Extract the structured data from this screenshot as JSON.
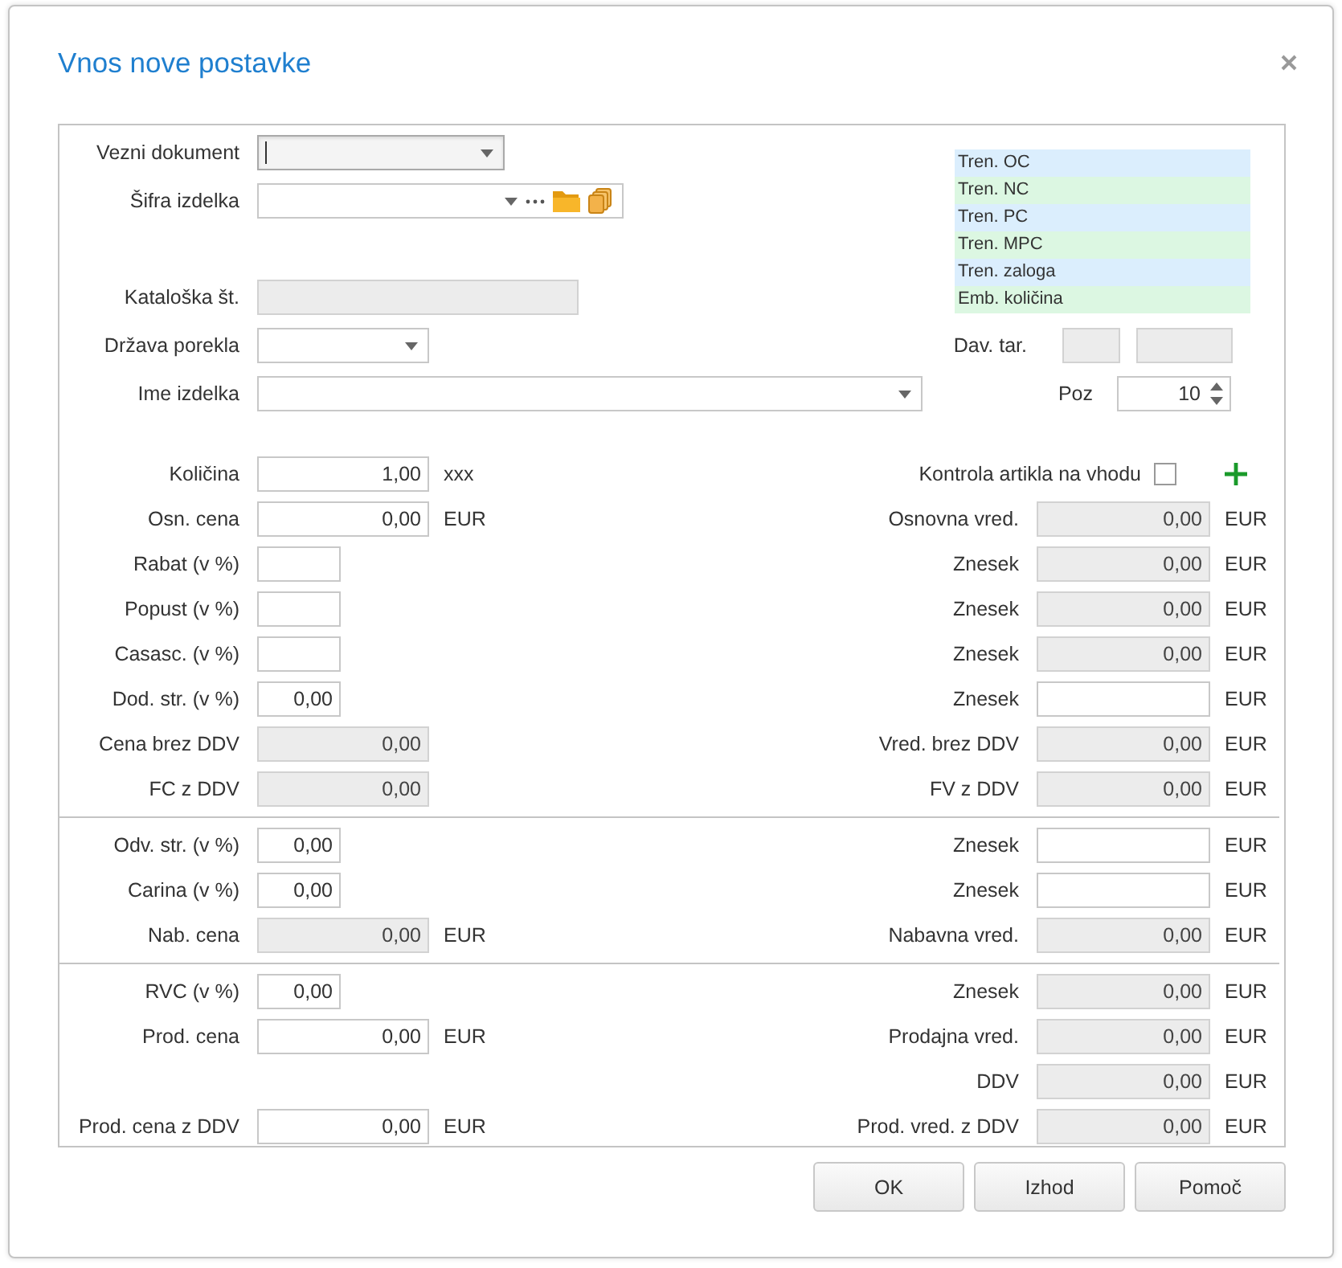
{
  "window": {
    "title": "Vnos nove postavke"
  },
  "header": {
    "fields": [
      {
        "label": "Vezni dokument",
        "kind": "combo",
        "focused": true,
        "readonly": false
      },
      {
        "label": "Šifra izdelka",
        "kind": "lookup",
        "focused": false,
        "readonly": false
      },
      {
        "label": "Kataloška št.",
        "kind": "text",
        "focused": false,
        "readonly": true
      },
      {
        "label": "Država porekla",
        "kind": "combo",
        "focused": false,
        "readonly": false
      },
      {
        "label": "Ime izdelka",
        "kind": "combo",
        "focused": false,
        "readonly": false
      }
    ],
    "price_list": [
      "Tren. OC",
      "Tren. NC",
      "Tren. PC",
      "Tren. MPC",
      "Tren. zaloga",
      "Emb. količina"
    ],
    "tariff": {
      "label": "Dav. tar."
    },
    "position": {
      "label": "Poz",
      "value": "10"
    }
  },
  "sections": [
    {
      "rows": [
        {
          "left": {
            "label": "Količina",
            "value": "1,00",
            "unit": "xxx",
            "kind": "amount",
            "readonly": false
          },
          "right": {
            "kind": "check",
            "label": "Kontrola artikla na vhodu",
            "checked": false
          }
        },
        {
          "left": {
            "label": "Osn. cena",
            "value": "0,00",
            "unit": "EUR",
            "kind": "amount",
            "readonly": false
          },
          "right": {
            "kind": "field",
            "label": "Osnovna vred.",
            "value": "0,00",
            "unit": "EUR",
            "readonly": true
          }
        },
        {
          "left": {
            "label": "Rabat (v %)",
            "kind": "percent",
            "readonly": false
          },
          "right": {
            "kind": "field",
            "label": "Znesek",
            "value": "0,00",
            "unit": "EUR",
            "readonly": true
          }
        },
        {
          "left": {
            "label": "Popust (v %)",
            "kind": "percent",
            "readonly": false
          },
          "right": {
            "kind": "field",
            "label": "Znesek",
            "value": "0,00",
            "unit": "EUR",
            "readonly": true
          }
        },
        {
          "left": {
            "label": "Casasc. (v %)",
            "kind": "percent",
            "readonly": false
          },
          "right": {
            "kind": "field",
            "label": "Znesek",
            "value": "0,00",
            "unit": "EUR",
            "readonly": true
          }
        },
        {
          "left": {
            "label": "Dod. str. (v %)",
            "value": "0,00",
            "kind": "percent",
            "readonly": false
          },
          "right": {
            "kind": "field",
            "label": "Znesek",
            "unit": "EUR",
            "readonly": false
          }
        },
        {
          "left": {
            "label": "Cena brez DDV",
            "value": "0,00",
            "kind": "amount",
            "readonly": true
          },
          "right": {
            "kind": "field",
            "label": "Vred. brez DDV",
            "value": "0,00",
            "unit": "EUR",
            "readonly": true
          }
        },
        {
          "left": {
            "label": "FC z DDV",
            "value": "0,00",
            "kind": "amount",
            "readonly": true
          },
          "right": {
            "kind": "field",
            "label": "FV z DDV",
            "value": "0,00",
            "unit": "EUR",
            "readonly": true
          }
        }
      ]
    },
    {
      "rows": [
        {
          "left": {
            "label": "Odv. str. (v %)",
            "value": "0,00",
            "kind": "percent",
            "readonly": false
          },
          "right": {
            "kind": "field",
            "label": "Znesek",
            "unit": "EUR",
            "readonly": false
          }
        },
        {
          "left": {
            "label": "Carina (v %)",
            "value": "0,00",
            "kind": "percent",
            "readonly": false
          },
          "right": {
            "kind": "field",
            "label": "Znesek",
            "unit": "EUR",
            "readonly": false
          }
        },
        {
          "left": {
            "label": "Nab. cena",
            "value": "0,00",
            "unit": "EUR",
            "kind": "amount",
            "readonly": true
          },
          "right": {
            "kind": "field",
            "label": "Nabavna vred.",
            "value": "0,00",
            "unit": "EUR",
            "readonly": true
          }
        }
      ]
    },
    {
      "rows": [
        {
          "left": {
            "label": "RVC (v %)",
            "value": "0,00",
            "kind": "percent",
            "readonly": false
          },
          "right": {
            "kind": "field",
            "label": "Znesek",
            "value": "0,00",
            "unit": "EUR",
            "readonly": true
          }
        },
        {
          "left": {
            "label": "Prod. cena",
            "value": "0,00",
            "unit": "EUR",
            "kind": "amount",
            "readonly": false
          },
          "right": {
            "kind": "field",
            "label": "Prodajna vred.",
            "value": "0,00",
            "unit": "EUR",
            "readonly": true
          }
        },
        {
          "right": {
            "kind": "field",
            "label": "DDV",
            "value": "0,00",
            "unit": "EUR",
            "readonly": true
          }
        },
        {
          "left": {
            "label": "Prod. cena z DDV",
            "value": "0,00",
            "unit": "EUR",
            "kind": "amount",
            "readonly": false
          },
          "right": {
            "kind": "field",
            "label": "Prod. vred. z DDV",
            "value": "0,00",
            "unit": "EUR",
            "readonly": true
          }
        }
      ]
    }
  ],
  "buttons": [
    "OK",
    "Izhod",
    "Pomoč"
  ]
}
